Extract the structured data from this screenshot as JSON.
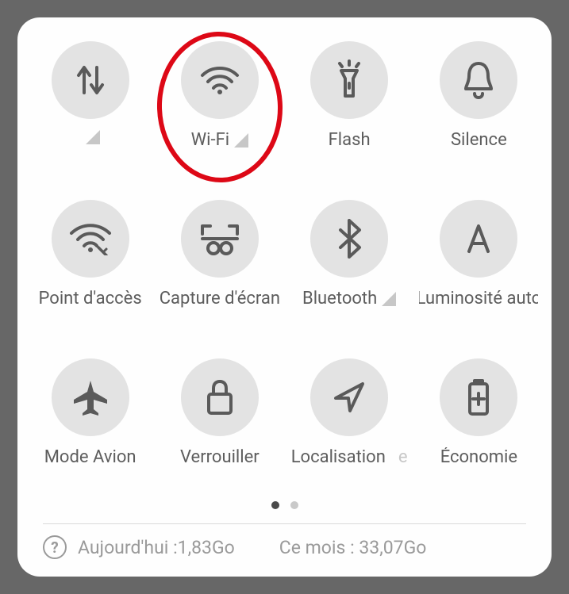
{
  "tiles": [
    {
      "label": "",
      "icon": "data-arrows",
      "signal": true
    },
    {
      "label": "Wi-Fi",
      "icon": "wifi",
      "signal": true,
      "highlighted": true
    },
    {
      "label": "Flash",
      "icon": "flashlight",
      "signal": false
    },
    {
      "label": "Silence",
      "icon": "bell",
      "signal": false
    },
    {
      "label": "Point d'accès",
      "icon": "hotspot",
      "signal": false
    },
    {
      "label": "Capture d'écran",
      "icon": "screenshot",
      "signal": false
    },
    {
      "label": "Bluetooth",
      "icon": "bluetooth",
      "signal": true
    },
    {
      "label": "Luminosité auto",
      "icon": "letter-a",
      "signal": false
    },
    {
      "label": "Mode Avion",
      "icon": "airplane",
      "signal": false
    },
    {
      "label": "Verrouiller",
      "icon": "lock",
      "signal": false
    },
    {
      "label": "Localisation",
      "icon": "navigation",
      "signal_after_text": "e"
    },
    {
      "label": "Économie",
      "icon": "battery",
      "signal": false
    }
  ],
  "pager": {
    "total": 2,
    "active": 0
  },
  "footer": {
    "today_label": "Aujourd'hui :1,83Go",
    "month_label": "Ce mois : 33,07Go"
  }
}
